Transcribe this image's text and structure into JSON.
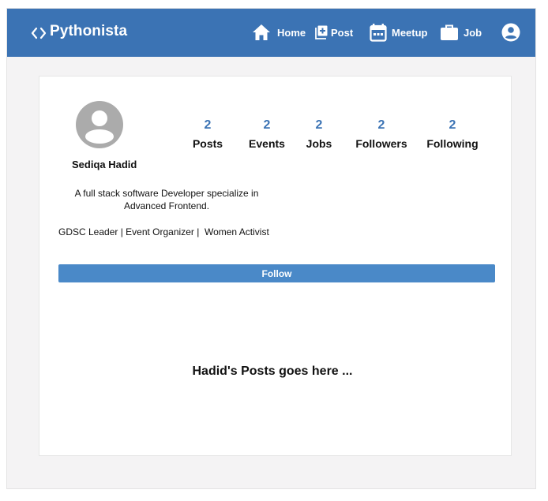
{
  "header": {
    "brand": "Pythonista",
    "brand_icon": "code-brackets-icon",
    "bg_color": "#3b73b4",
    "nav": [
      {
        "label": "Home",
        "icon": "home-icon"
      },
      {
        "label": "Post",
        "icon": "add-post-icon"
      },
      {
        "label": "Meetup",
        "icon": "calendar-icon"
      },
      {
        "label": "Job",
        "icon": "briefcase-icon"
      }
    ],
    "account_icon": "account-circle-icon"
  },
  "profile": {
    "name": "Sediqa Hadid",
    "avatar_icon": "user-avatar-icon",
    "stats": [
      {
        "value": "2",
        "label": "Posts"
      },
      {
        "value": "2",
        "label": "Events"
      },
      {
        "value": "2",
        "label": "Jobs"
      },
      {
        "value": "2",
        "label": "Followers"
      },
      {
        "value": "2",
        "label": "Following"
      }
    ],
    "bio_line1": "A full stack software Developer specialize in",
    "bio_line2": "Advanced Frontend.",
    "tags": "GDSC Leader | Event Organizer |  Women Activist",
    "follow_label": "Follow",
    "accent_color": "#4a89c8"
  },
  "posts": {
    "placeholder": "Hadid's Posts goes here ..."
  }
}
